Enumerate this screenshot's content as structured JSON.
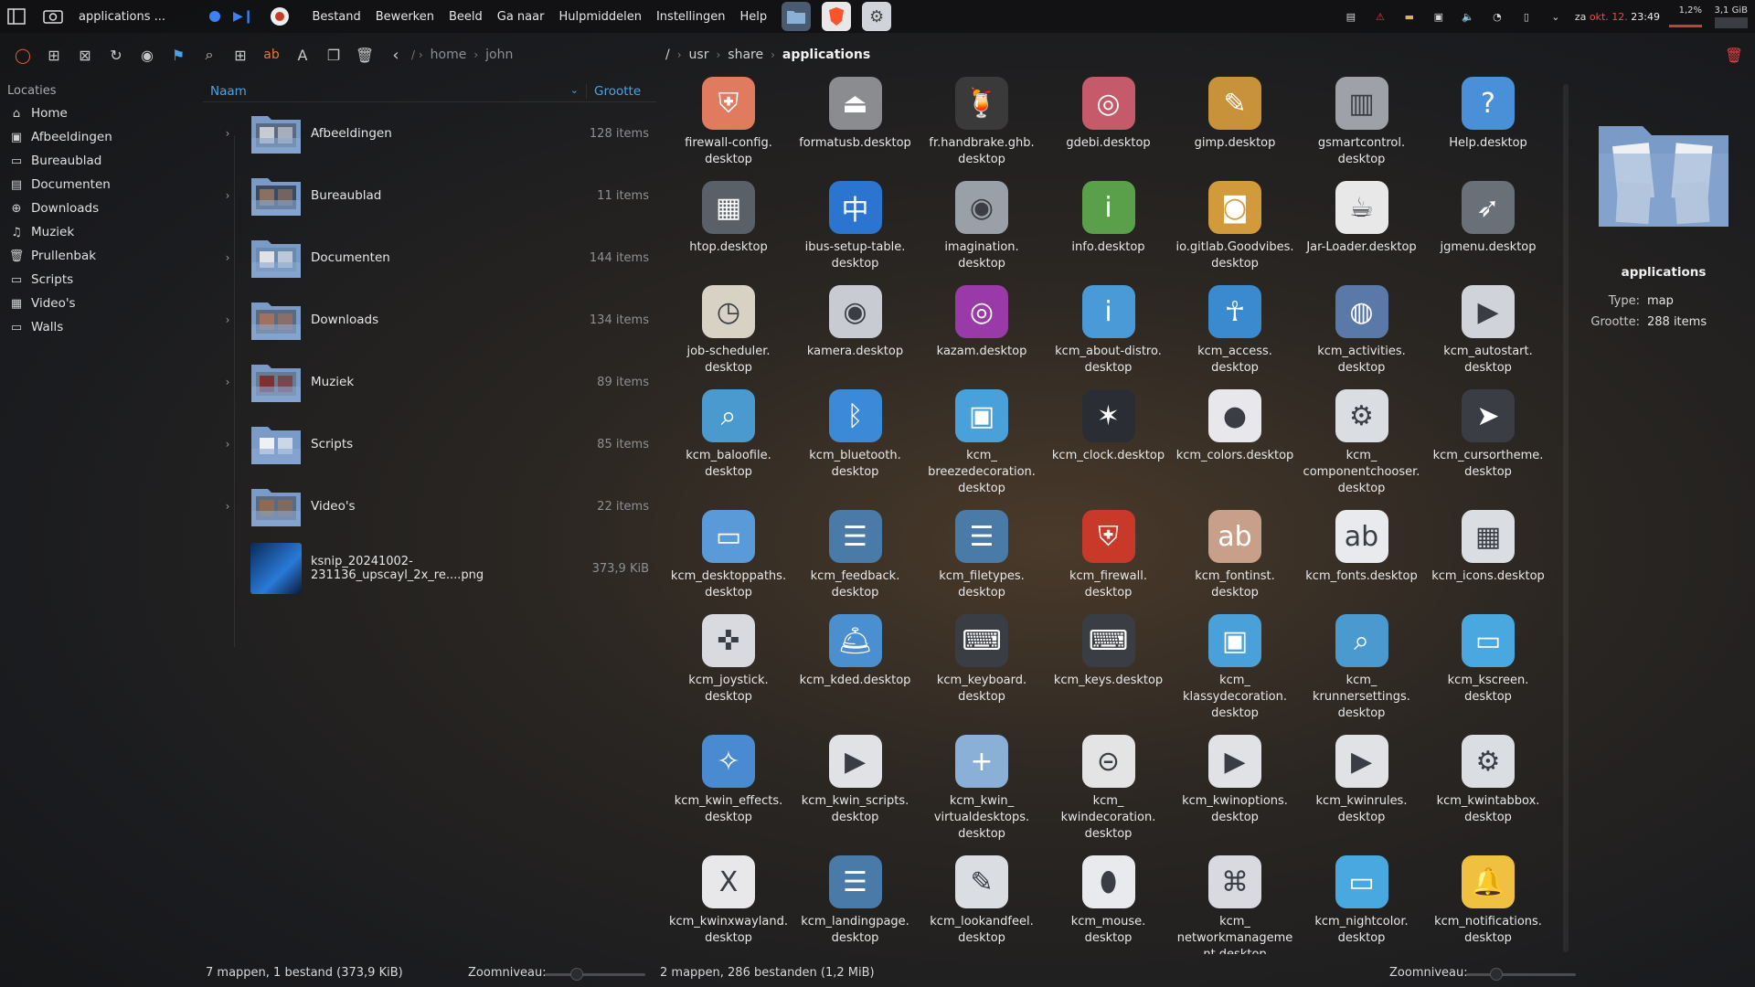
{
  "topbar": {
    "window_title": "applications ...",
    "menus": [
      "Bestand",
      "Bewerken",
      "Beeld",
      "Ga naar",
      "Hulpmiddelen",
      "Instellingen",
      "Help"
    ],
    "tray": {
      "cpu": "1,2%",
      "mem": "3,1 GiB",
      "date_prefix": "za ",
      "date": "okt. 12.",
      "time": "23:49"
    }
  },
  "toolbar": {
    "breadcrumb_left": [
      "home",
      "john"
    ],
    "breadcrumb_right": [
      "/",
      "usr",
      "share",
      "applications"
    ]
  },
  "sidebar": {
    "title": "Locaties",
    "items": [
      {
        "label": "Home",
        "icon": "home-icon",
        "glyph": "⌂"
      },
      {
        "label": "Afbeeldingen",
        "icon": "image-icon",
        "glyph": "▣"
      },
      {
        "label": "Bureaublad",
        "icon": "desktop-icon",
        "glyph": "▭"
      },
      {
        "label": "Documenten",
        "icon": "document-icon",
        "glyph": "▤"
      },
      {
        "label": "Downloads",
        "icon": "download-icon",
        "glyph": "⊕"
      },
      {
        "label": "Muziek",
        "icon": "music-icon",
        "glyph": "♫"
      },
      {
        "label": "Prullenbak",
        "icon": "trash-icon",
        "glyph": "🗑"
      },
      {
        "label": "Scripts",
        "icon": "folder-icon",
        "glyph": "▭"
      },
      {
        "label": "Video's",
        "icon": "video-icon",
        "glyph": "▦"
      },
      {
        "label": "Walls",
        "icon": "folder-icon",
        "glyph": "▭"
      }
    ]
  },
  "listpane": {
    "col_name": "Naam",
    "col_size": "Grootte",
    "rows": [
      {
        "name": "Afbeeldingen",
        "size": "128 items",
        "expandable": true
      },
      {
        "name": "Bureaublad",
        "size": "11 items",
        "expandable": true
      },
      {
        "name": "Documenten",
        "size": "144 items",
        "expandable": true
      },
      {
        "name": "Downloads",
        "size": "134 items",
        "expandable": true
      },
      {
        "name": "Muziek",
        "size": "89 items",
        "expandable": true
      },
      {
        "name": "Scripts",
        "size": "85 items",
        "expandable": true
      },
      {
        "name": "Video's",
        "size": "22 items",
        "expandable": true
      },
      {
        "name": "ksnip_20241002-231136_upscayl_2x_re....png",
        "size": "373,9 KiB",
        "expandable": false
      }
    ]
  },
  "grid": {
    "items": [
      {
        "label": "firewall-config.\ndesktop",
        "glyph": "⛨",
        "color": "#e07b5f"
      },
      {
        "label": "formatusb.desktop",
        "glyph": "⏏",
        "color": "#8a8c90"
      },
      {
        "label": "fr.handbrake.ghb.\ndesktop",
        "glyph": "🍹",
        "color": "#3a3a3a"
      },
      {
        "label": "gdebi.desktop",
        "glyph": "◎",
        "color": "#c45a6a"
      },
      {
        "label": "gimp.desktop",
        "glyph": "✎",
        "color": "#c8923a"
      },
      {
        "label": "gsmartcontrol.\ndesktop",
        "glyph": "▥",
        "color": "#9ea2a8"
      },
      {
        "label": "Help.desktop",
        "glyph": "?",
        "color": "#4a90d9"
      },
      {
        "label": "htop.desktop",
        "glyph": "▦",
        "color": "#5a6068"
      },
      {
        "label": "ibus-setup-table.\ndesktop",
        "glyph": "中",
        "color": "#2b74d0"
      },
      {
        "label": "imagination.\ndesktop",
        "glyph": "◉",
        "color": "#9aa0a8"
      },
      {
        "label": "info.desktop",
        "glyph": "i",
        "color": "#5aa04a"
      },
      {
        "label": "io.gitlab.Goodvibes.\ndesktop",
        "glyph": "◙",
        "color": "#d29a3a"
      },
      {
        "label": "Jar-Loader.desktop",
        "glyph": "☕",
        "color": "#e8e8e8"
      },
      {
        "label": "jgmenu.desktop",
        "glyph": "➶",
        "color": "#6a7078"
      },
      {
        "label": "job-scheduler.\ndesktop",
        "glyph": "◷",
        "color": "#d8d2c4"
      },
      {
        "label": "kamera.desktop",
        "glyph": "◉",
        "color": "#c8ccd2"
      },
      {
        "label": "kazam.desktop",
        "glyph": "◎",
        "color": "#9a3aa8"
      },
      {
        "label": "kcm_about-distro.\ndesktop",
        "glyph": "i",
        "color": "#4a9ad8"
      },
      {
        "label": "kcm_access.\ndesktop",
        "glyph": "☥",
        "color": "#3a8ad0"
      },
      {
        "label": "kcm_activities.\ndesktop",
        "glyph": "◍",
        "color": "#5a78a8"
      },
      {
        "label": "kcm_autostart.\ndesktop",
        "glyph": "▶",
        "color": "#d0d4da"
      },
      {
        "label": "kcm_baloofile.\ndesktop",
        "glyph": "⌕",
        "color": "#4a9ad0"
      },
      {
        "label": "kcm_bluetooth.\ndesktop",
        "glyph": "ᛒ",
        "color": "#3a8ad8"
      },
      {
        "label": "kcm_\nbreezedecoration.\ndesktop",
        "glyph": "▣",
        "color": "#4aa0d8"
      },
      {
        "label": "kcm_clock.desktop",
        "glyph": "✶",
        "color": "#2a2e34"
      },
      {
        "label": "kcm_colors.desktop",
        "glyph": "●",
        "color": "#e8e8ec"
      },
      {
        "label": "kcm_\ncomponentchooser.\ndesktop",
        "glyph": "⚙",
        "color": "#dadde2"
      },
      {
        "label": "kcm_cursortheme.\ndesktop",
        "glyph": "➤",
        "color": "#3a3e44"
      },
      {
        "label": "kcm_desktoppaths.\ndesktop",
        "glyph": "▭",
        "color": "#5a9ad8"
      },
      {
        "label": "kcm_feedback.\ndesktop",
        "glyph": "☰",
        "color": "#4a7aa8"
      },
      {
        "label": "kcm_filetypes.\ndesktop",
        "glyph": "☰",
        "color": "#4a7aa8"
      },
      {
        "label": "kcm_firewall.\ndesktop",
        "glyph": "⛨",
        "color": "#c8392a"
      },
      {
        "label": "kcm_fontinst.\ndesktop",
        "glyph": "ab",
        "color": "#c8a08a"
      },
      {
        "label": "kcm_fonts.desktop",
        "glyph": "ab",
        "color": "#e8eaee"
      },
      {
        "label": "kcm_icons.desktop",
        "glyph": "▦",
        "color": "#dadde2"
      },
      {
        "label": "kcm_joystick.\ndesktop",
        "glyph": "✜",
        "color": "#d8dadf"
      },
      {
        "label": "kcm_kded.desktop",
        "glyph": "🛎",
        "color": "#4a90d0"
      },
      {
        "label": "kcm_keyboard.\ndesktop",
        "glyph": "⌨",
        "color": "#3a3e44"
      },
      {
        "label": "kcm_keys.desktop",
        "glyph": "⌨",
        "color": "#3a3e44"
      },
      {
        "label": "kcm_\nklassydecoration.\ndesktop",
        "glyph": "▣",
        "color": "#4aa0d8"
      },
      {
        "label": "kcm_\nkrunnersettings.\ndesktop",
        "glyph": "⌕",
        "color": "#4a9ad0"
      },
      {
        "label": "kcm_kscreen.\ndesktop",
        "glyph": "▭",
        "color": "#4aa8e0"
      },
      {
        "label": "kcm_kwin_effects.\ndesktop",
        "glyph": "✧",
        "color": "#4a8ad0"
      },
      {
        "label": "kcm_kwin_scripts.\ndesktop",
        "glyph": "▶",
        "color": "#e0e2e6"
      },
      {
        "label": "kcm_kwin_\nvirtualdesktops.\ndesktop",
        "glyph": "+",
        "color": "#8ab0d8"
      },
      {
        "label": "kcm_\nkwindecoration.\ndesktop",
        "glyph": "⊝",
        "color": "#e4e4e4"
      },
      {
        "label": "kcm_kwinoptions.\ndesktop",
        "glyph": "▶",
        "color": "#e0e2e6"
      },
      {
        "label": "kcm_kwinrules.\ndesktop",
        "glyph": "▶",
        "color": "#e0e2e6"
      },
      {
        "label": "kcm_kwintabbox.\ndesktop",
        "glyph": "⚙",
        "color": "#dadde2"
      },
      {
        "label": "kcm_kwinxwayland.\ndesktop",
        "glyph": "X",
        "color": "#e8e8ea"
      },
      {
        "label": "kcm_landingpage.\ndesktop",
        "glyph": "☰",
        "color": "#4a7aa8"
      },
      {
        "label": "kcm_lookandfeel.\ndesktop",
        "glyph": "✎",
        "color": "#dadde2"
      },
      {
        "label": "kcm_mouse.\ndesktop",
        "glyph": "⬮",
        "color": "#e8eaee"
      },
      {
        "label": "kcm_\nnetworkmanageme\nnt.desktop",
        "glyph": "⌘",
        "color": "#d8dadf"
      },
      {
        "label": "kcm_nightcolor.\ndesktop",
        "glyph": "▭",
        "color": "#4aa8e0"
      },
      {
        "label": "kcm_notifications.\ndesktop",
        "glyph": "🔔",
        "color": "#f0c040"
      }
    ]
  },
  "infopanel": {
    "title": "applications",
    "type_label": "Type:",
    "type_value": "map",
    "size_label": "Grootte:",
    "size_value": "288 items"
  },
  "statusbar": {
    "left_text": "7 mappen, 1 bestand (373,9 KiB)",
    "zoom_label_left": "Zoomniveau:",
    "middle_text": "2 mappen, 286 bestanden (1,2 MiB)",
    "zoom_label_right": "Zoomniveau:"
  }
}
